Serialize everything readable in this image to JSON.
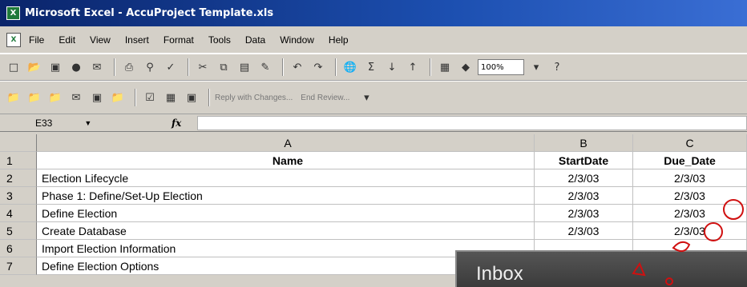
{
  "window": {
    "title": "Microsoft Excel - AccuProject Template.xls",
    "app_icon_glyph": "X"
  },
  "menu": {
    "doc_icon_glyph": "X",
    "items": [
      "File",
      "Edit",
      "View",
      "Insert",
      "Format",
      "Tools",
      "Data",
      "Window",
      "Help"
    ]
  },
  "toolbar": {
    "zoom": "100%",
    "reply_label": "Reply with Changes...",
    "end_review_label": "End Review..."
  },
  "formula_bar": {
    "namebox": "E33",
    "fx": "fx"
  },
  "sheet": {
    "columns": [
      "A",
      "B",
      "C"
    ],
    "rows": [
      {
        "num": "1",
        "a": "Name",
        "b": "StartDate",
        "c": "Due_Date"
      },
      {
        "num": "2",
        "a": "Election Lifecycle",
        "b": "2/3/03",
        "c": "2/3/03"
      },
      {
        "num": "3",
        "a": "Phase 1:  Define/Set-Up Election",
        "b": "2/3/03",
        "c": "2/3/03"
      },
      {
        "num": "4",
        "a": "Define Election",
        "b": "2/3/03",
        "c": "2/3/03"
      },
      {
        "num": "5",
        "a": "Create Database",
        "b": "2/3/03",
        "c": "2/3/03"
      },
      {
        "num": "6",
        "a": "Import Election Information",
        "b": "",
        "c": ""
      },
      {
        "num": "7",
        "a": "Define Election Options",
        "b": "",
        "c": ""
      }
    ]
  },
  "overlay": {
    "title": "Inbox"
  },
  "colors": {
    "titlebar": "#0a246a",
    "chrome": "#d4d0c8",
    "watermark": "#d01010"
  }
}
